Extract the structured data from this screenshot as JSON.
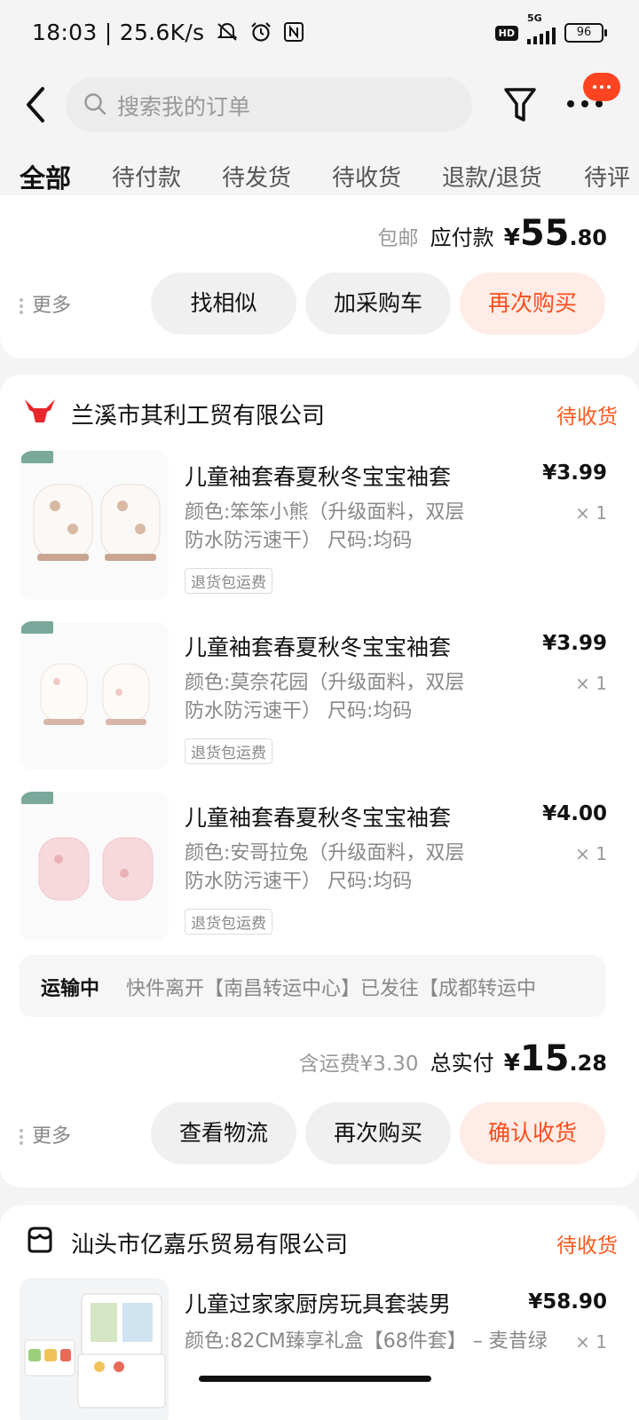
{
  "status_bar": {
    "time_speed": "18:03 | 25.6K/s",
    "hd": "HD",
    "network": "5G",
    "battery": "96"
  },
  "header": {
    "search_placeholder": "搜索我的订单"
  },
  "tabs": [
    "全部",
    "待付款",
    "待发货",
    "待收货",
    "退款/退货",
    "待评"
  ],
  "order_prev": {
    "shipping": "包邮",
    "amount_label": "应付款",
    "currency": "¥",
    "amount_int": "55",
    "amount_dec": ".80",
    "more": "更多",
    "buttons": [
      "找相似",
      "加采购车",
      "再次购买"
    ]
  },
  "order_1": {
    "shop": "兰溪市其利工贸有限公司",
    "status": "待收货",
    "items": [
      {
        "title": "儿童袖套春夏秋冬宝宝袖套",
        "spec": "颜色:笨笨小熊（升级面料，双层防水防污速干） 尺码:均码",
        "tag": "退货包运费",
        "price": "¥3.99",
        "qty": "× 1"
      },
      {
        "title": "儿童袖套春夏秋冬宝宝袖套",
        "spec": "颜色:莫奈花园（升级面料，双层防水防污速干） 尺码:均码",
        "tag": "退货包运费",
        "price": "¥3.99",
        "qty": "× 1"
      },
      {
        "title": "儿童袖套春夏秋冬宝宝袖套",
        "spec": "颜色:安哥拉兔（升级面料，双层防水防污速干） 尺码:均码",
        "tag": "退货包运费",
        "price": "¥4.00",
        "qty": "× 1"
      }
    ],
    "logistics_label": "运输中",
    "logistics_text": "快件离开【南昌转运中心】已发往【成都转运中",
    "shipping_fee": "含运费¥3.30",
    "total_label": "总实付",
    "currency": "¥",
    "total_int": "15",
    "total_dec": ".28",
    "more": "更多",
    "buttons": [
      "查看物流",
      "再次购买",
      "确认收货"
    ]
  },
  "order_2": {
    "shop": "汕头市亿嘉乐贸易有限公司",
    "status": "待收货",
    "item": {
      "title": "儿童过家家厨房玩具套装男",
      "spec": "颜色:82CM臻享礼盒【68件套】 – 麦昔绿",
      "price": "¥58.90",
      "qty": "× 1"
    }
  },
  "colors": {
    "accent": "#ff4d1a",
    "accent_bg": "#ffece6",
    "badge": "#ff4422"
  },
  "icons": [
    "back-arrow-icon",
    "search-icon",
    "filter-icon",
    "more-icon",
    "bull-shop-icon",
    "store-icon",
    "dnd-icon",
    "alarm-icon",
    "nfc-icon"
  ]
}
